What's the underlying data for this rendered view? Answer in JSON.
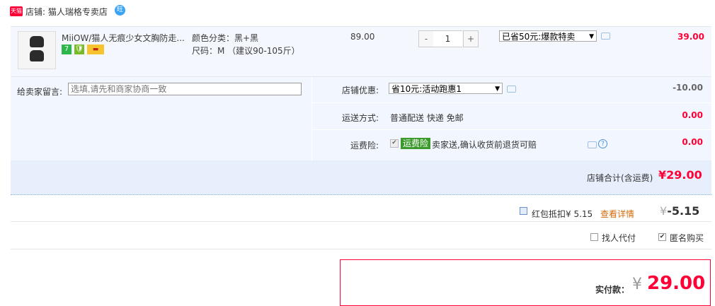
{
  "shop": {
    "badge": "天猫",
    "name_label": "店铺: 猫人瑞格专卖店",
    "wangwang": "旺"
  },
  "item": {
    "title": "MiiOW/猫人无痕少女文胸防走...",
    "sku_color": "颜色分类：黑+黑",
    "sku_size": "尺码：M （建议90-105斤）",
    "price": "89.00",
    "qty_minus": "-",
    "quantity": "1",
    "qty_plus": "+",
    "promo_selected": "已省50元:爆款特卖",
    "subtotal": "39.00",
    "service_icons": [
      "seven-day-return-icon",
      "quality-guarantee-icon",
      "credit-card-icon"
    ],
    "svc_seven": "7",
    "svc_guarantee": "🛡",
    "svc_card": "▬"
  },
  "message": {
    "label": "给卖家留言:",
    "placeholder": "选填,请先和商家协商一致"
  },
  "options": {
    "shop_promo_label": "店铺优惠:",
    "shop_promo_selected": "省10元:活动跑惠1",
    "shop_promo_value": "-10.00",
    "shipping_label": "运送方式:",
    "shipping_value": "普通配送 快递 免邮",
    "shipping_fee": "0.00",
    "insurance_label": "运费险:",
    "insurance_tag": "运费险",
    "insurance_text": "卖家送,确认收货前退货可赔",
    "insurance_fee": "0.00",
    "help": "?"
  },
  "shop_total": {
    "label": "店铺合计(含运费)",
    "value": "¥29.00"
  },
  "red_packet": {
    "label": "红包抵扣¥ 5.15",
    "link": "查看详情",
    "yen": "¥",
    "value": "-5.15"
  },
  "extras": {
    "friend_pay": "找人代付",
    "anonymous": "匿名购买",
    "anonymous_checked": "✔"
  },
  "payment": {
    "label": "实付款：",
    "yen": "¥",
    "amount": "29.00"
  },
  "colors": {
    "accent_red": "#ff0036",
    "panel_blue": "#f2f7ff",
    "total_blue": "#e6effb"
  }
}
